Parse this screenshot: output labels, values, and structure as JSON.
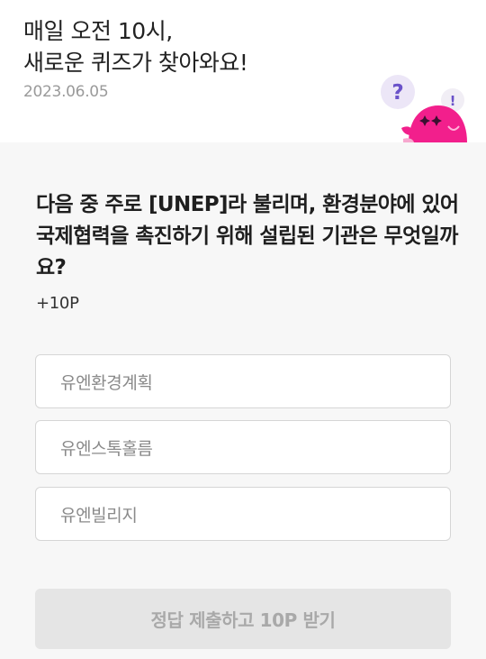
{
  "header": {
    "title_line1": "매일 오전 10시,",
    "title_line2": "새로운 퀴즈가 찾아와요!",
    "date": "2023.06.05"
  },
  "quiz": {
    "question": "다음 중 주로 [UNEP]라 불리며, 환경분야에 있어 국제협력을 촉진하기 위해 설립된 기관은 무엇일까요?",
    "points": "+10P",
    "options": [
      "유엔환경계획",
      "유엔스톡홀름",
      "유엔빌리지"
    ],
    "submit_label": "정답 제출하고 10P 받기"
  },
  "colors": {
    "mascot": "#f21f8c",
    "bubble": "#ece6f7",
    "bubble_mark": "#6a52c9",
    "submit_bg": "#e5e5e5"
  },
  "icons": [
    "question-bubble-icon",
    "exclamation-bubble-icon",
    "mascot-character-icon"
  ]
}
